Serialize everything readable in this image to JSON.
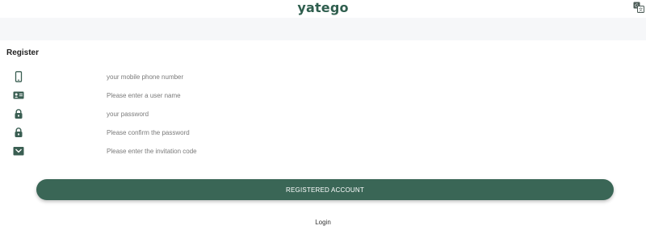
{
  "header": {
    "logo": "yatego",
    "translate_icon": "translate-icon"
  },
  "page": {
    "section_title": "Register"
  },
  "form": {
    "fields": [
      {
        "icon": "phone-icon",
        "placeholder": "your mobile phone number",
        "value": ""
      },
      {
        "icon": "id-card-icon",
        "placeholder": "Please enter a user name",
        "value": ""
      },
      {
        "icon": "lock-icon",
        "placeholder": "your password",
        "value": ""
      },
      {
        "icon": "lock-icon",
        "placeholder": "Please confirm the password",
        "value": ""
      },
      {
        "icon": "envelope-icon",
        "placeholder": "Please enter the invitation code",
        "value": ""
      }
    ],
    "register_label": "REGISTERED ACCOUNT",
    "login_label": "Login"
  },
  "colors": {
    "brand": "#2f5e4e",
    "button": "#3a6656",
    "subheader_bg": "#f6f7f9"
  }
}
